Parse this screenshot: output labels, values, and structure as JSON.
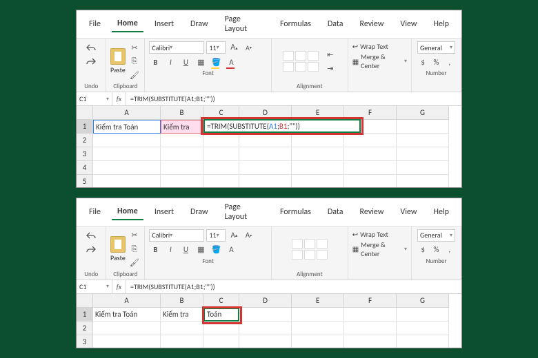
{
  "menus": {
    "file": "File",
    "home": "Home",
    "insert": "Insert",
    "draw": "Draw",
    "layout": "Page Layout",
    "formulas": "Formulas",
    "data": "Data",
    "review": "Review",
    "view": "View",
    "help": "Help"
  },
  "ribbon": {
    "undo": "Undo",
    "clipboard": "Clipboard",
    "paste": "Paste",
    "font": "Font",
    "alignment": "Alignment",
    "number": "Number",
    "fontName": "Calibri",
    "fontSize": "11",
    "wrap": "Wrap Text",
    "merge": "Merge & Center",
    "numFormat": "General",
    "bold": "B",
    "italic": "I",
    "underline": "U",
    "incA": "A",
    "decA": "A"
  },
  "formulaBar": {
    "cellRef": "C1",
    "fx": "fx",
    "formula": "=TRIM(SUBSTITUTE(A1;B1;\"\"))"
  },
  "columns": [
    "A",
    "B",
    "C",
    "D",
    "E",
    "F",
    "G"
  ],
  "rows": [
    "1",
    "2",
    "3",
    "4",
    "5"
  ],
  "top": {
    "a1": "Kiểm tra Toán",
    "b1": "Kiểm tra",
    "formulaPrefix": "=TRIM(SUBSTITUTE(",
    "tokA": "A1",
    "sep1": ";",
    "tokB": "B1",
    "sep2": ";",
    "quote": "\"\"",
    "close": "))"
  },
  "bottom": {
    "a1": "Kiểm tra Toán",
    "b1": "Kiểm tra",
    "c1": "Toán",
    "rows": [
      "1",
      "2",
      "3"
    ]
  }
}
